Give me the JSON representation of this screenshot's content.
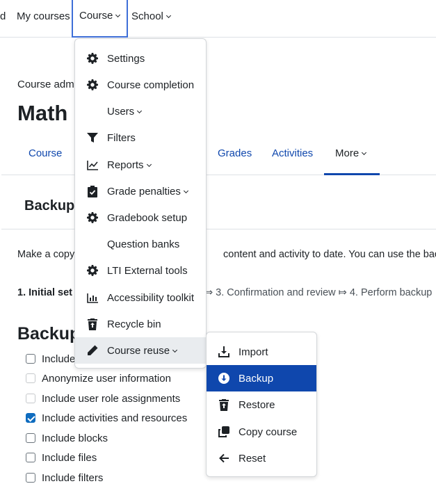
{
  "topnav": {
    "items": [
      {
        "label": "d"
      },
      {
        "label": "My courses"
      },
      {
        "label": "Course"
      },
      {
        "label": "School"
      }
    ]
  },
  "header": {
    "breadcrumb": "Course admi",
    "title": "Math"
  },
  "subnav": {
    "tabs": [
      {
        "label": "Course"
      },
      {
        "label": "Grades"
      },
      {
        "label": "Activities"
      },
      {
        "label": "More"
      }
    ]
  },
  "section": {
    "title": "Backup",
    "intro_left": "Make a copy",
    "intro_right": "content and activity to date. You can use the backu",
    "step_current": "1. Initial set",
    "steps_rest": "⤇ 3. Confirmation and review ⤇ 4. Perform backup",
    "settings_title": "Backup"
  },
  "checkboxes": [
    {
      "label": "Include",
      "checked": false,
      "disabled": false
    },
    {
      "label": "Anonymize user information",
      "checked": false,
      "disabled": true
    },
    {
      "label": "Include user role assignments",
      "checked": false,
      "disabled": true
    },
    {
      "label": "Include activities and resources",
      "checked": true,
      "disabled": false
    },
    {
      "label": "Include blocks",
      "checked": false,
      "disabled": false
    },
    {
      "label": "Include files",
      "checked": false,
      "disabled": false
    },
    {
      "label": "Include filters",
      "checked": false,
      "disabled": false
    }
  ],
  "course_menu": {
    "items": [
      {
        "label": "Settings",
        "icon": "gear-icon"
      },
      {
        "label": "Course completion",
        "icon": "gear-icon"
      },
      {
        "label": "Users",
        "icon": "",
        "submenu": true
      },
      {
        "label": "Filters",
        "icon": "filter-icon"
      },
      {
        "label": "Reports",
        "icon": "line-chart-icon",
        "submenu": true
      },
      {
        "label": "Grade penalties",
        "icon": "clipboard-check-icon",
        "submenu": true
      },
      {
        "label": "Gradebook setup",
        "icon": "gear-icon"
      },
      {
        "label": "Question banks",
        "icon": ""
      },
      {
        "label": "LTI External tools",
        "icon": "gear-icon"
      },
      {
        "label": "Accessibility toolkit",
        "icon": "bar-chart-icon"
      },
      {
        "label": "Recycle bin",
        "icon": "trash-restore-icon"
      },
      {
        "label": "Course reuse",
        "icon": "pencil-icon",
        "submenu": true
      }
    ]
  },
  "reuse_menu": {
    "items": [
      {
        "label": "Import",
        "icon": "import-icon"
      },
      {
        "label": "Backup",
        "icon": "download-circle-icon"
      },
      {
        "label": "Restore",
        "icon": "trash-restore-icon"
      },
      {
        "label": "Copy course",
        "icon": "copy-icon"
      },
      {
        "label": "Reset",
        "icon": "arrow-left-icon"
      }
    ]
  },
  "colors": {
    "accent": "#0f47ad",
    "link": "#0f47ad",
    "active_outline": "#3d6ed8",
    "checkbox_checked": "#0f6cbf"
  }
}
